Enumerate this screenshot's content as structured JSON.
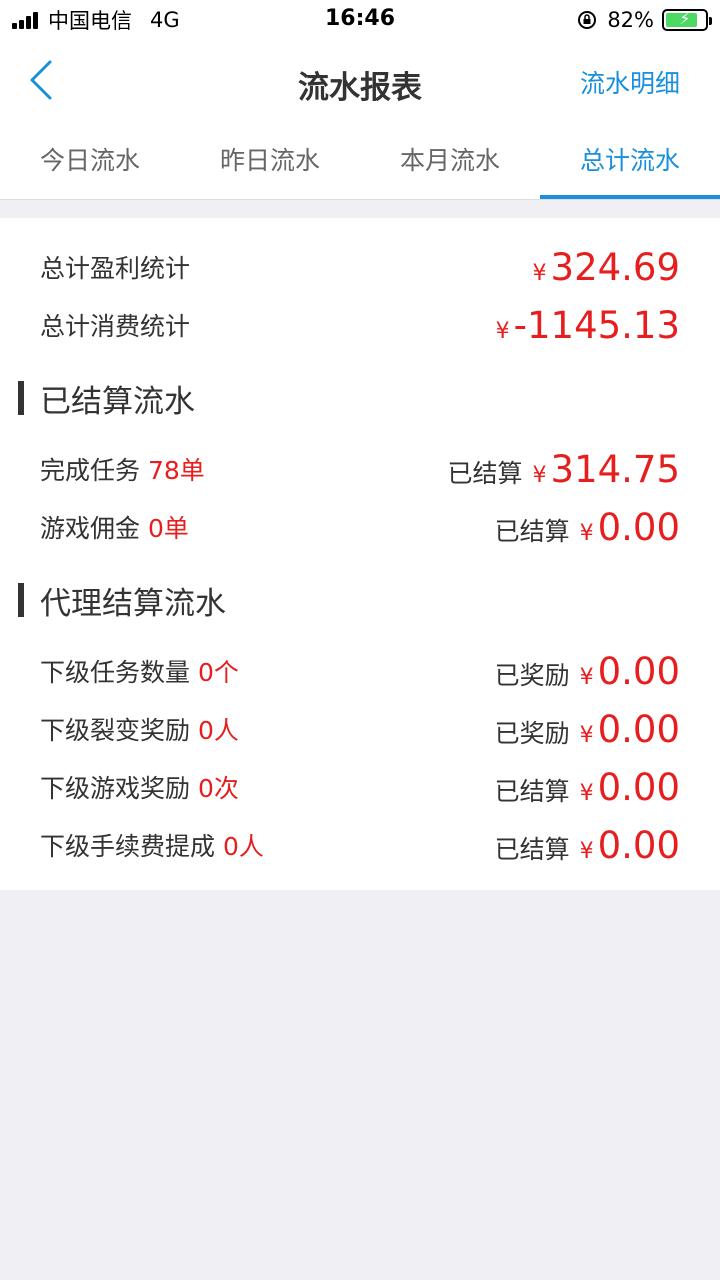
{
  "status_bar": {
    "carrier": "中国电信",
    "network": "4G",
    "time": "16:46",
    "battery": "82%",
    "battery_level": 0.82,
    "icons": [
      "signal-icon",
      "orientation-lock-icon",
      "battery-icon"
    ]
  },
  "nav": {
    "title": "流水报表",
    "right_action": "流水明细",
    "back_icon": "chevron-left-icon"
  },
  "tabs": [
    {
      "label": "今日流水",
      "active": false
    },
    {
      "label": "昨日流水",
      "active": false
    },
    {
      "label": "本月流水",
      "active": false
    },
    {
      "label": "总计流水",
      "active": true
    }
  ],
  "summary": {
    "profit_label": "总计盈利统计",
    "profit_value": "324.69",
    "consume_label": "总计消费统计",
    "consume_value": "-1145.13"
  },
  "settled": {
    "title": "已结算流水",
    "rows": [
      {
        "label": "完成任务",
        "count": "78单",
        "status": "已结算",
        "value": "314.75"
      },
      {
        "label": "游戏佣金",
        "count": "0单",
        "status": "已结算",
        "value": "0.00"
      }
    ]
  },
  "agent": {
    "title": "代理结算流水",
    "rows": [
      {
        "label": "下级任务数量",
        "count": "0个",
        "status": "已奖励",
        "value": "0.00"
      },
      {
        "label": "下级裂变奖励",
        "count": "0人",
        "status": "已奖励",
        "value": "0.00"
      },
      {
        "label": "下级游戏奖励",
        "count": "0次",
        "status": "已结算",
        "value": "0.00"
      },
      {
        "label": "下级手续费提成",
        "count": "0人",
        "status": "已结算",
        "value": "0.00"
      }
    ]
  },
  "currency_symbol": "¥",
  "colors": {
    "accent": "#1a8fdc",
    "amount": "#e61e1e",
    "background": "#efeff4"
  }
}
